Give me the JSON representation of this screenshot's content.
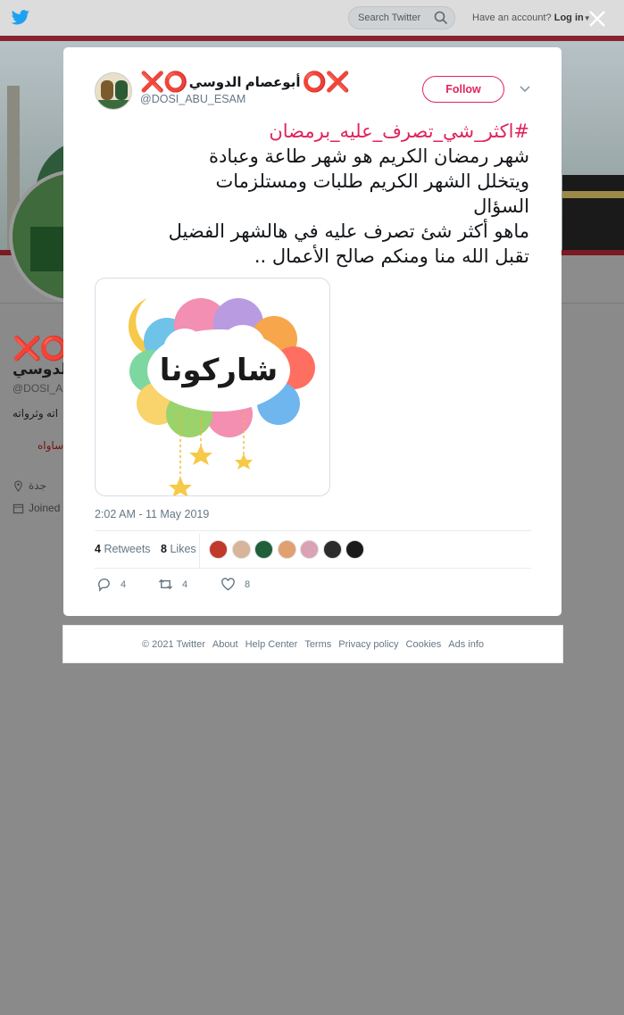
{
  "topbar": {
    "search_placeholder": "Search Twitter",
    "have_account": "Have an account?",
    "login_label": "Log in"
  },
  "profile": {
    "name_icons": "❌⭕",
    "name": "الدوسي",
    "handle": "@DOSI_A",
    "bio_line1": "اته وثرواته",
    "bio_line2": "ساواه",
    "location": "جدة",
    "joined": "Joined"
  },
  "tweet": {
    "xo_left": "❌⭕",
    "display_name": "أبوعصام الدوسي",
    "xo_right": "⭕❌",
    "handle": "@DOSI_ABU_ESAM",
    "follow_label": "Follow",
    "hashtag": "#اكثر_شي_تصرف_عليه_برمضان",
    "lines": [
      "شهر رمضان الكريم هو شهر طاعة وعبادة",
      "ويتخلل الشهر الكريم طلبات ومستلزمات",
      "السؤال",
      "ماهو أكثر شئ تصرف عليه في هالشهر الفضيل",
      "تقبل الله منا ومنكم صالح الأعمال .."
    ],
    "image_text": "شاركونا",
    "timestamp": "2:02 AM - 11 May 2019",
    "retweets_count": "4",
    "retweets_label": "Retweets",
    "likes_count": "8",
    "likes_label": "Likes",
    "likers": [
      "#c0392b",
      "#d8b49a",
      "#1f5f3a",
      "#e0a070",
      "#d9a3b5",
      "#2c2c2c",
      "#1a1a1a"
    ],
    "reply_count": "4",
    "retweet_count": "4",
    "like_count": "8"
  },
  "footer": {
    "items": [
      "© 2021 Twitter",
      "About",
      "Help Center",
      "Terms",
      "Privacy policy",
      "Cookies",
      "Ads info"
    ]
  }
}
